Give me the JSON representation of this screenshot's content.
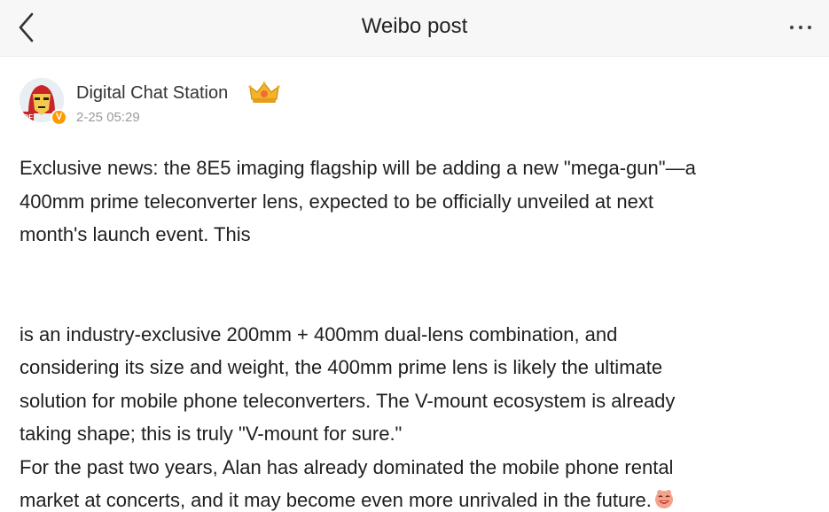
{
  "header": {
    "title": "Weibo post",
    "back_icon": "chevron-left-icon",
    "more_icon": "more-horizontal-icon"
  },
  "author": {
    "name": "Digital Chat Station",
    "time": "2-25 05:29",
    "avatar_icon": "ironman-avatar",
    "badge_icon": "verified-v-badge",
    "badge_text": "V",
    "crown_icon": "gold-crown-icon",
    "badge_color": "#ff9a00"
  },
  "post": {
    "lines": [
      "Exclusive news: the 8E5 imaging flagship will be adding a new \"mega-gun\"—a",
      "400mm prime teleconverter lens, expected to be officially unveiled at next",
      "month's launch event. This",
      "is an industry-exclusive 200mm + 400mm dual-lens combination, and",
      "considering its size and weight, the 400mm prime lens is likely the ultimate",
      "solution for mobile phone teleconverters. The V-mount ecosystem is already",
      "taking shape; this is truly \"V-mount for sure.\"",
      "For the past two years, Alan has already dominated the mobile phone rental",
      "market at concerts, and it may become even more unrivaled in the future."
    ],
    "end_emoji": "laughing-face-emoji"
  }
}
